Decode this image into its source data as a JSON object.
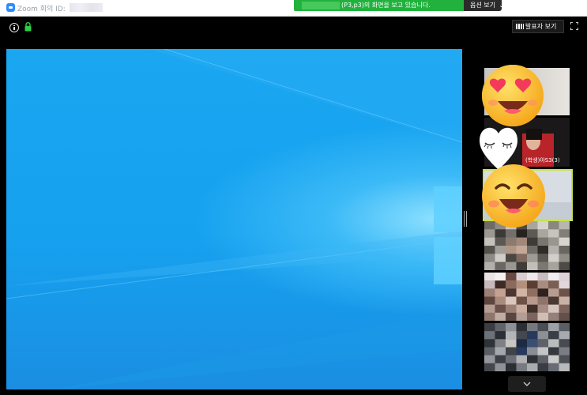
{
  "window": {
    "title": "Zoom 회의 ID:"
  },
  "share_banner": {
    "text": "(P3,p3)의 화면을 보고 있습니다.",
    "options_label": "옵션 보기"
  },
  "toolbar": {
    "speaker_view_label": "발표자 보기"
  },
  "participants": [
    {
      "name": ""
    },
    {
      "name": "(학생)아S3(3)"
    },
    {
      "name": ""
    },
    {
      "name": ""
    },
    {
      "name": ""
    },
    {
      "name": ""
    }
  ],
  "colors": {
    "share_banner": "#21b23d",
    "active_speaker_border": "#c7e24a",
    "desktop_blue": "#16a1ef"
  },
  "icons": [
    "zoom-logo-icon",
    "info-icon",
    "lock-icon",
    "grid-icon",
    "fullscreen-icon",
    "chevron-down-icon",
    "heart-eyes-emoji-icon",
    "heart-emoji-icon",
    "smile-emoji-icon"
  ]
}
